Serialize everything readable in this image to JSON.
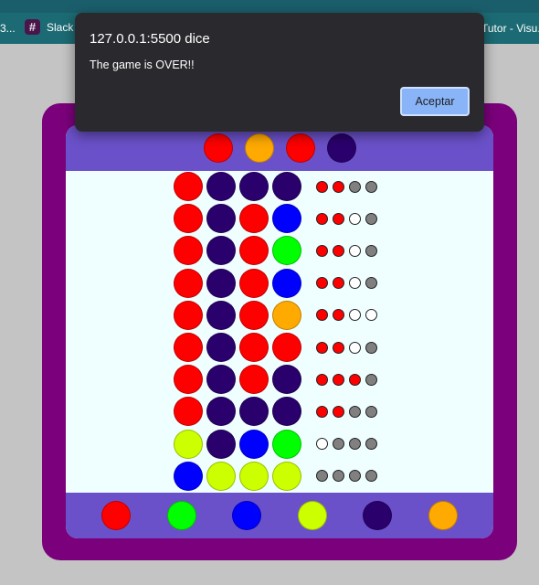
{
  "bookmarks": {
    "fragment_label": "3...",
    "slack_label": "Slack",
    "tutor_label": "Tutor - Visu..."
  },
  "dialog": {
    "title": "127.0.0.1:5500 dice",
    "message": "The game is OVER!!",
    "ok_label": "Aceptar"
  },
  "colors": {
    "red": "#ff0000",
    "orange": "#ffaa00",
    "indigo": "#2a006c",
    "blue": "#0000ff",
    "green": "#00ff00",
    "lime": "#ccff00",
    "hint_exact": "#ff0000",
    "hint_present": "#ffffff",
    "hint_none": "#808080"
  },
  "secret_code": [
    "red",
    "orange",
    "red",
    "indigo"
  ],
  "guesses": [
    {
      "pegs": [
        "red",
        "indigo",
        "indigo",
        "indigo"
      ],
      "hints": [
        "hint_exact",
        "hint_exact",
        "hint_none",
        "hint_none"
      ]
    },
    {
      "pegs": [
        "red",
        "indigo",
        "red",
        "blue"
      ],
      "hints": [
        "hint_exact",
        "hint_exact",
        "hint_present",
        "hint_none"
      ]
    },
    {
      "pegs": [
        "red",
        "indigo",
        "red",
        "green"
      ],
      "hints": [
        "hint_exact",
        "hint_exact",
        "hint_present",
        "hint_none"
      ]
    },
    {
      "pegs": [
        "red",
        "indigo",
        "red",
        "blue"
      ],
      "hints": [
        "hint_exact",
        "hint_exact",
        "hint_present",
        "hint_none"
      ]
    },
    {
      "pegs": [
        "red",
        "indigo",
        "red",
        "orange"
      ],
      "hints": [
        "hint_exact",
        "hint_exact",
        "hint_present",
        "hint_present"
      ]
    },
    {
      "pegs": [
        "red",
        "indigo",
        "red",
        "red"
      ],
      "hints": [
        "hint_exact",
        "hint_exact",
        "hint_present",
        "hint_none"
      ]
    },
    {
      "pegs": [
        "red",
        "indigo",
        "red",
        "indigo"
      ],
      "hints": [
        "hint_exact",
        "hint_exact",
        "hint_exact",
        "hint_none"
      ]
    },
    {
      "pegs": [
        "red",
        "indigo",
        "indigo",
        "indigo"
      ],
      "hints": [
        "hint_exact",
        "hint_exact",
        "hint_none",
        "hint_none"
      ]
    },
    {
      "pegs": [
        "lime",
        "indigo",
        "blue",
        "green"
      ],
      "hints": [
        "hint_present",
        "hint_none",
        "hint_none",
        "hint_none"
      ]
    },
    {
      "pegs": [
        "blue",
        "lime",
        "lime",
        "lime"
      ],
      "hints": [
        "hint_none",
        "hint_none",
        "hint_none",
        "hint_none"
      ]
    }
  ],
  "palette": [
    "red",
    "green",
    "blue",
    "lime",
    "indigo",
    "orange"
  ]
}
